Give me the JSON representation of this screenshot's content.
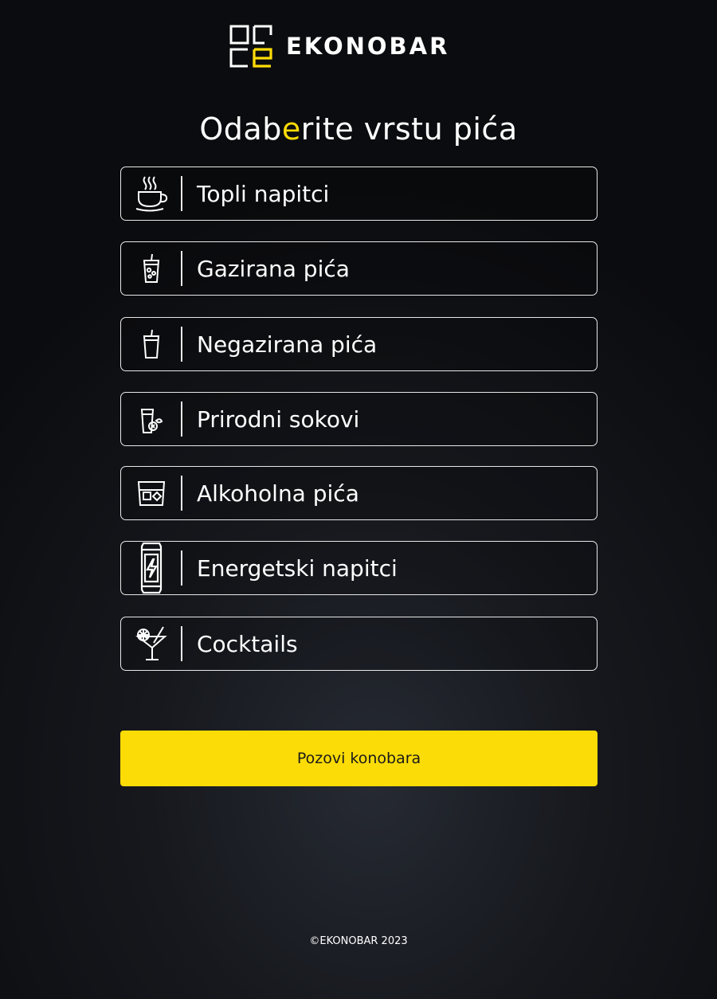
{
  "brand": {
    "name": "EKONOBAR",
    "accent_color": "#fcdc06"
  },
  "title": {
    "part1": "Odab",
    "accent": "e",
    "part2": "rite vrstu pića"
  },
  "categories": [
    {
      "label": "Topli napitci",
      "icon": "hot-cup-icon"
    },
    {
      "label": "Gazirana pića",
      "icon": "fizzy-glass-icon"
    },
    {
      "label": "Negazirana pića",
      "icon": "still-glass-icon"
    },
    {
      "label": "Prirodni sokovi",
      "icon": "juice-glass-icon"
    },
    {
      "label": "Alkoholna pića",
      "icon": "whisky-glass-icon"
    },
    {
      "label": "Energetski napitci",
      "icon": "energy-can-icon"
    },
    {
      "label": "Cocktails",
      "icon": "cocktail-glass-icon"
    }
  ],
  "call_waiter": {
    "label": "Pozovi konobara"
  },
  "footer": {
    "text": "©EKONOBAR 2023"
  }
}
